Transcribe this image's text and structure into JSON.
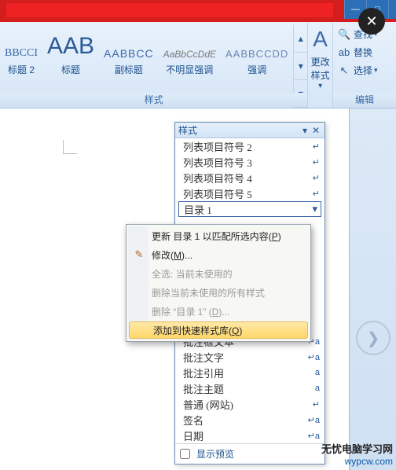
{
  "window": {
    "min": "—",
    "restore": "□",
    "close_x": "✕"
  },
  "ribbon": {
    "gallery": [
      {
        "sample_class": "s-h2",
        "preview": "BBCCI",
        "name": "标题 2"
      },
      {
        "sample_class": "s-title",
        "preview": "AAB",
        "name": "标题"
      },
      {
        "sample_class": "s-sub",
        "preview": "AABBCC",
        "name": "副标题"
      },
      {
        "sample_class": "s-subtle",
        "preview": "AaBbCcDdE",
        "name": "不明显强调"
      },
      {
        "sample_class": "s-emph",
        "preview": "AABBCCDD",
        "name": "强调"
      }
    ],
    "change_styles": "更改样式",
    "group_styles": "样式",
    "group_editing": "编辑",
    "editing": {
      "find": "查找",
      "replace": "替换",
      "select": "选择"
    }
  },
  "style_pane": {
    "title": "样式",
    "items_above": [
      {
        "name": "列表项目符号 2",
        "marker": "↵"
      },
      {
        "name": "列表项目符号 3",
        "marker": "↵"
      },
      {
        "name": "列表项目符号 4",
        "marker": "↵"
      },
      {
        "name": "列表项目符号 5",
        "marker": "↵"
      }
    ],
    "selected": {
      "name": "目录 1",
      "marker": "▾"
    },
    "items_below": [
      {
        "name": "批注框文本",
        "marker": "↵a"
      },
      {
        "name": "批注文字",
        "marker": "↵a"
      },
      {
        "name": "批注引用",
        "marker": "a"
      },
      {
        "name": "批注主题",
        "marker": "a"
      },
      {
        "name": "普通 (网站)",
        "marker": "↵"
      },
      {
        "name": "签名",
        "marker": "↵a"
      },
      {
        "name": "日期",
        "marker": "↵a"
      }
    ],
    "show_preview": "显示预览"
  },
  "context_menu": {
    "update_match": {
      "pre": "更新 目录 1 以匹配所选内容(",
      "key": "P",
      "post": ")"
    },
    "modify": {
      "pre": "修改(",
      "key": "M",
      "post": ")..."
    },
    "select_all": "全选: 当前未使用的",
    "delete_all": "删除当前未使用的所有样式",
    "delete_one": {
      "pre": "删除 “目录 1” (",
      "key": "D",
      "post": ")..."
    },
    "add_quick": {
      "pre": "添加到快速样式库(",
      "key": "Q",
      "post": ")"
    }
  },
  "watermark": {
    "line1": "无忧电脑学习网",
    "line2": "wypcw.com"
  }
}
